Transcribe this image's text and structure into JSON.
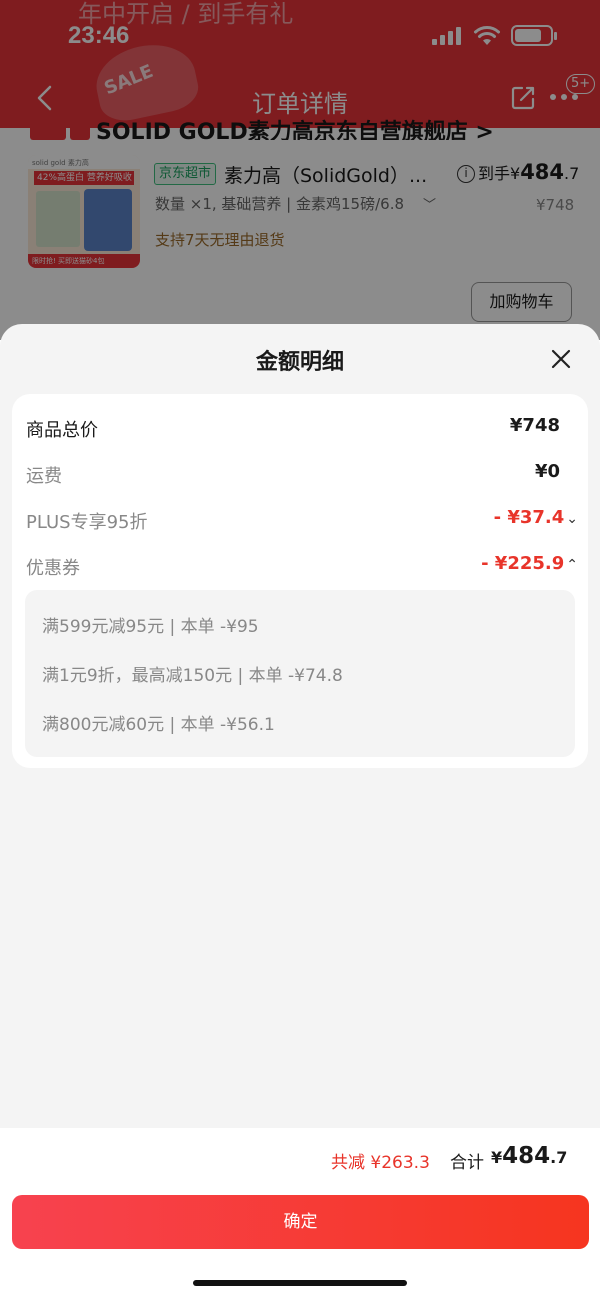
{
  "status_bar": {
    "time": "23:46"
  },
  "nav": {
    "title": "订单详情",
    "badge": "5+"
  },
  "background": {
    "banner_text": "年中开启 / 到手有礼",
    "sale_text": "SALE",
    "shop_name": "SOLID GOLD素力高京东自营旗舰店 >",
    "product": {
      "thumb_top": "solid gold 素力高",
      "thumb_red": "42%高蛋白 营养好吸收",
      "thumb_bottom": "限时抢! 买即送猫砂4包",
      "tag": "京东超市",
      "title": "素力高（SolidGold）...",
      "info_symbol": "i",
      "final_price_prefix": "到手¥",
      "final_price_int": "484",
      "final_price_dec": ".7",
      "spec": "数量 ×1, 基础营养 | 金素鸡15磅/6.8",
      "orig_price": "¥748",
      "return_policy": "支持7天无理由退货",
      "add_cart": "加购物车"
    }
  },
  "sheet": {
    "title": "金额明细",
    "rows": [
      {
        "label": "商品总价",
        "value": "¥748"
      },
      {
        "label": "运费",
        "value": "¥0"
      },
      {
        "label": "PLUS专享95折",
        "value": "- ¥37.4",
        "chevron": "⌄"
      },
      {
        "label": "优惠券",
        "value": "- ¥225.9",
        "chevron": "⌃"
      }
    ],
    "coupons": [
      "满599元减95元 | 本单 -¥95",
      "满1元9折，最高减150元 | 本单 -¥74.8",
      "满800元减60元 | 本单 -¥56.1"
    ]
  },
  "footer": {
    "total_save": "共减 ¥263.3",
    "total_label": "合计",
    "total_prefix": "¥",
    "total_int": "484",
    "total_dec": ".7",
    "confirm": "确定"
  },
  "colors": {
    "brand_red": "#e8343a",
    "discount_red": "#e8342a",
    "jd_green": "#1aa160"
  }
}
